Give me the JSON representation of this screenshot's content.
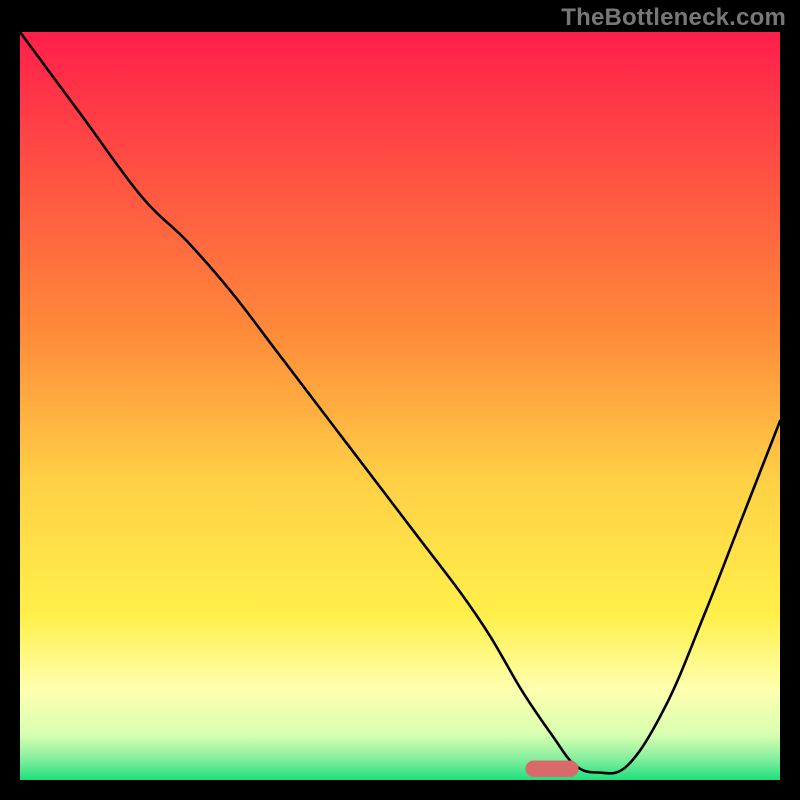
{
  "watermark": "TheBottleneck.com",
  "chart_data": {
    "type": "line",
    "title": "",
    "xlabel": "",
    "ylabel": "",
    "xlim": [
      0,
      100
    ],
    "ylim": [
      0,
      100
    ],
    "grid": false,
    "background_gradient": {
      "stops": [
        {
          "offset": 0,
          "color": "#ff1e4b"
        },
        {
          "offset": 40,
          "color": "#ff8a3a"
        },
        {
          "offset": 60,
          "color": "#ffd046"
        },
        {
          "offset": 78,
          "color": "#fff04a"
        },
        {
          "offset": 88,
          "color": "#ffffb0"
        },
        {
          "offset": 94,
          "color": "#d8ffb0"
        },
        {
          "offset": 97,
          "color": "#8af0a0"
        },
        {
          "offset": 100,
          "color": "#1ee07a"
        }
      ]
    },
    "curve": {
      "x": [
        0,
        8,
        16,
        22,
        28,
        34,
        40,
        46,
        52,
        58,
        62,
        66,
        70,
        73,
        76,
        80,
        85,
        90,
        95,
        100
      ],
      "y": [
        100,
        89,
        78,
        72,
        65,
        57,
        49,
        41,
        33,
        25,
        19,
        12,
        6,
        2,
        1,
        2,
        10,
        22,
        35,
        48
      ]
    },
    "marker": {
      "x": 70,
      "y": 1.5,
      "width": 7,
      "height": 2.2,
      "color": "#d86a6a"
    }
  }
}
